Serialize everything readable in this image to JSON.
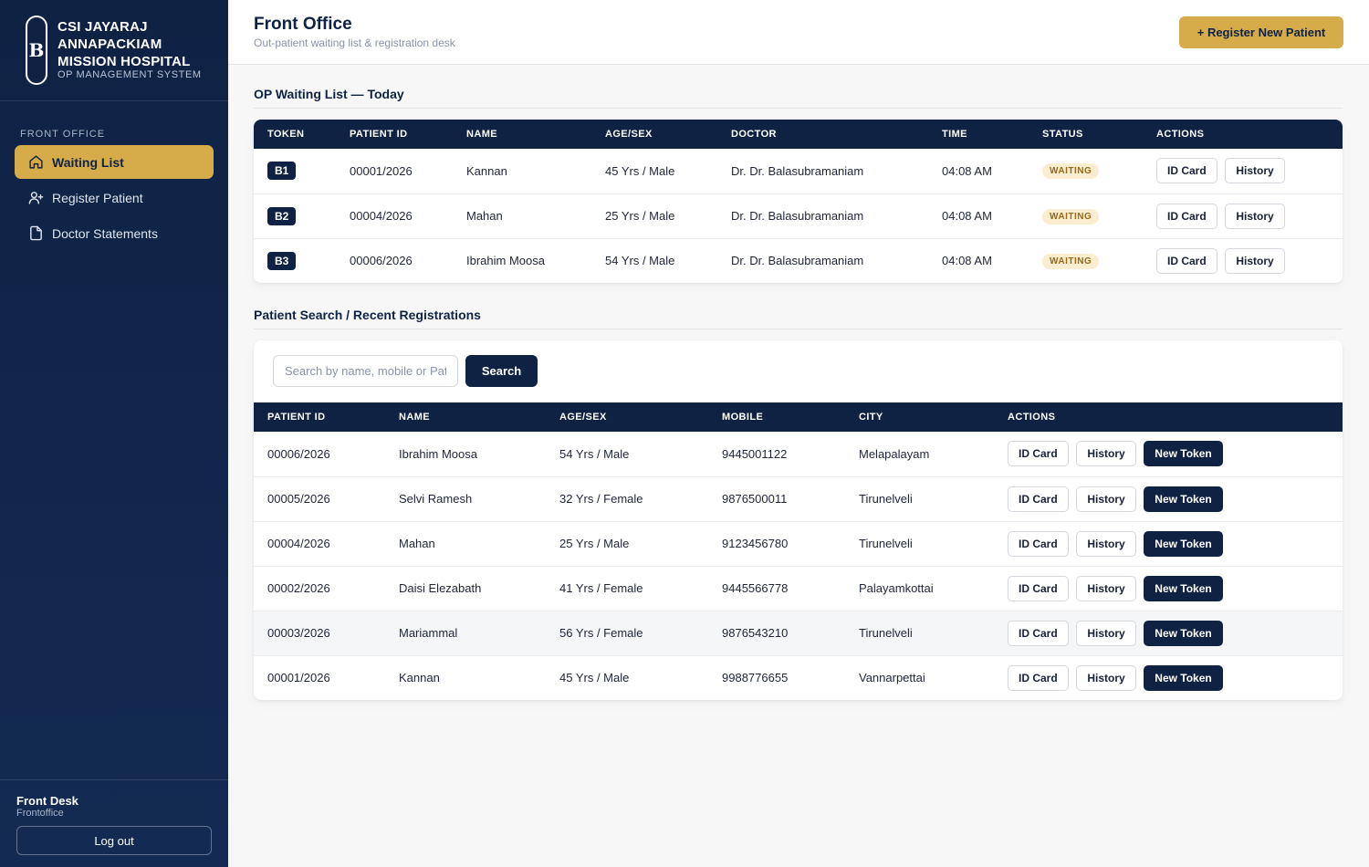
{
  "brand": {
    "logo_letter": "B",
    "name": "CSI JAYARAJ ANNAPACKIAM MISSION HOSPITAL",
    "subtitle": "OP MANAGEMENT SYSTEM"
  },
  "sidebar": {
    "section_label": "FRONT OFFICE",
    "items": [
      {
        "label": "Waiting List",
        "icon": "home-icon",
        "active": true
      },
      {
        "label": "Register Patient",
        "icon": "user-plus-icon",
        "active": false
      },
      {
        "label": "Doctor Statements",
        "icon": "document-icon",
        "active": false
      }
    ],
    "user": {
      "name": "Front Desk",
      "role": "Frontoffice",
      "logout_label": "Log out"
    }
  },
  "header": {
    "title": "Front Office",
    "subtitle": "Out-patient waiting list & registration desk",
    "register_button": "+ Register New Patient"
  },
  "waiting": {
    "title": "OP Waiting List — Today",
    "columns": [
      "TOKEN",
      "PATIENT ID",
      "NAME",
      "AGE/SEX",
      "DOCTOR",
      "TIME",
      "STATUS",
      "ACTIONS"
    ],
    "rows": [
      {
        "token": "B1",
        "patient_id": "00001/2026",
        "name": "Kannan",
        "age_sex": "45 Yrs / Male",
        "doctor": "Dr. Dr. Balasubramaniam",
        "time": "04:08 AM",
        "status": "WAITING"
      },
      {
        "token": "B2",
        "patient_id": "00004/2026",
        "name": "Mahan",
        "age_sex": "25 Yrs / Male",
        "doctor": "Dr. Dr. Balasubramaniam",
        "time": "04:08 AM",
        "status": "WAITING"
      },
      {
        "token": "B3",
        "patient_id": "00006/2026",
        "name": "Ibrahim Moosa",
        "age_sex": "54 Yrs / Male",
        "doctor": "Dr. Dr. Balasubramaniam",
        "time": "04:08 AM",
        "status": "WAITING"
      }
    ],
    "actions": {
      "id_card": "ID Card",
      "history": "History"
    }
  },
  "search": {
    "title": "Patient Search / Recent Registrations",
    "placeholder": "Search by name, mobile or Patient ID",
    "button": "Search",
    "columns": [
      "PATIENT ID",
      "NAME",
      "AGE/SEX",
      "MOBILE",
      "CITY",
      "ACTIONS"
    ],
    "rows": [
      {
        "patient_id": "00006/2026",
        "name": "Ibrahim Moosa",
        "age_sex": "54 Yrs / Male",
        "mobile": "9445001122",
        "city": "Melapalayam"
      },
      {
        "patient_id": "00005/2026",
        "name": "Selvi Ramesh",
        "age_sex": "32 Yrs / Female",
        "mobile": "9876500011",
        "city": "Tirunelveli"
      },
      {
        "patient_id": "00004/2026",
        "name": "Mahan",
        "age_sex": "25 Yrs / Male",
        "mobile": "9123456780",
        "city": "Tirunelveli"
      },
      {
        "patient_id": "00002/2026",
        "name": "Daisi Elezabath",
        "age_sex": "41 Yrs / Female",
        "mobile": "9445566778",
        "city": "Palayamkottai"
      },
      {
        "patient_id": "00003/2026",
        "name": "Mariammal",
        "age_sex": "56 Yrs / Female",
        "mobile": "9876543210",
        "city": "Tirunelveli"
      },
      {
        "patient_id": "00001/2026",
        "name": "Kannan",
        "age_sex": "45 Yrs / Male",
        "mobile": "9988776655",
        "city": "Vannarpettai"
      }
    ],
    "actions": {
      "id_card": "ID Card",
      "history": "History",
      "new_token": "New Token"
    }
  },
  "colors": {
    "navy": "#0f2244",
    "gold": "#d6ab4a",
    "badge_bg": "#fbeed0",
    "badge_text": "#94691a"
  }
}
